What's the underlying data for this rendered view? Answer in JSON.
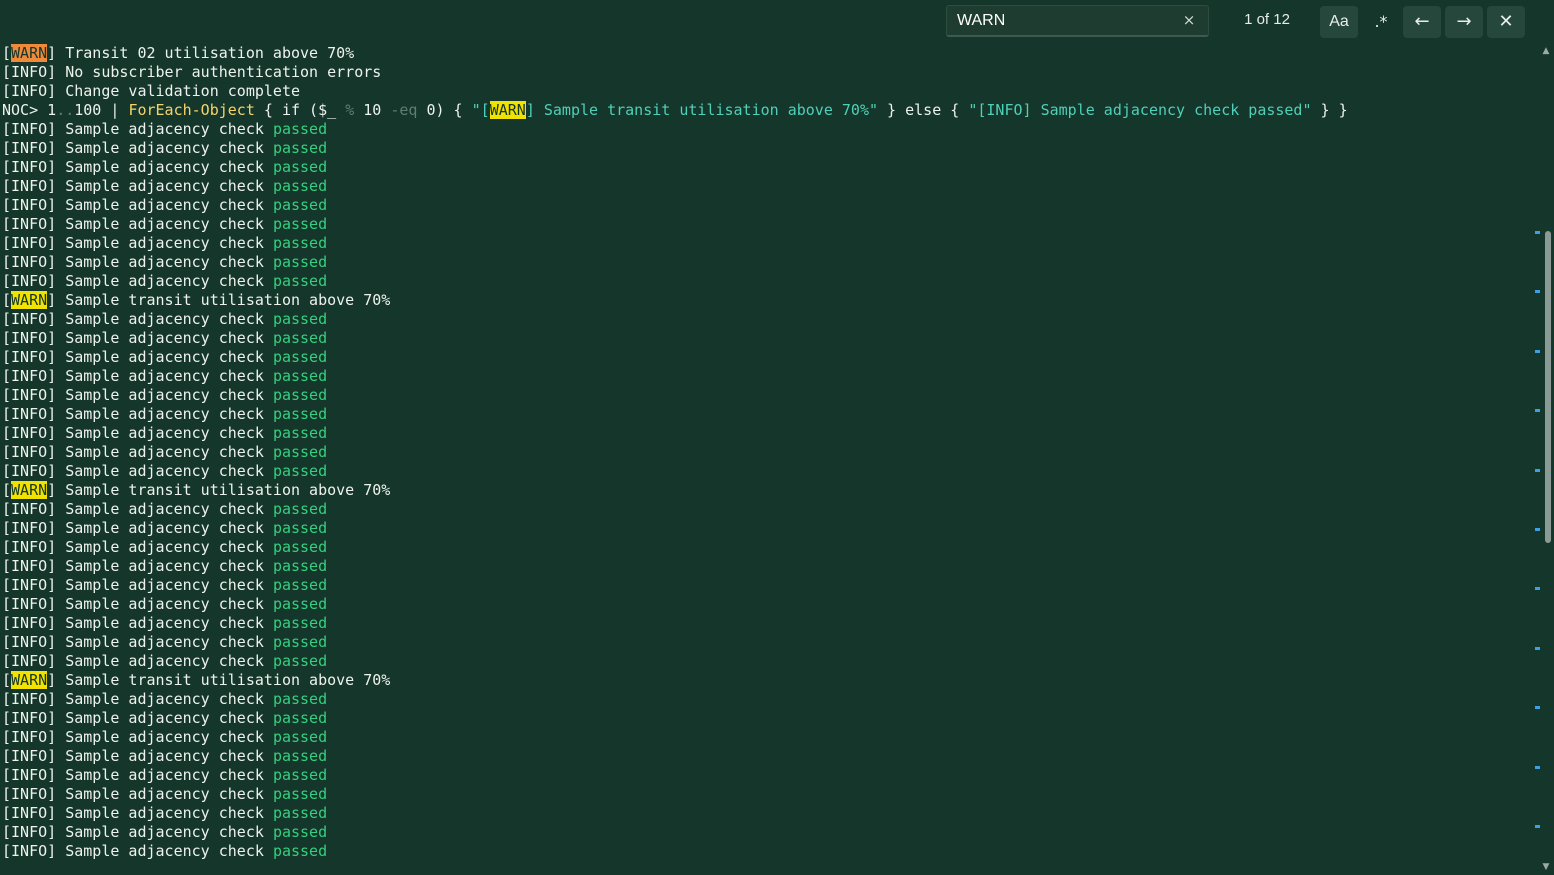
{
  "find": {
    "query": "WARN",
    "clear_icon": "×",
    "match_count": "1 of 12",
    "case_label": "Aa",
    "regex_label": ".*",
    "prev_icon": "←",
    "next_icon": "→",
    "close_icon": "✕"
  },
  "terminal": {
    "lines": [
      [
        {
          "t": "["
        },
        {
          "t": "WARN",
          "c": "hl-cur"
        },
        {
          "t": "] Transit 02 utilisation above 70%"
        }
      ],
      [
        {
          "t": "[INFO] No subscriber authentication errors"
        }
      ],
      [
        {
          "t": "[INFO] Change validation complete"
        }
      ],
      [
        {
          "t": "NOC> 1"
        },
        {
          "t": "..",
          "c": "cmd-dim"
        },
        {
          "t": "100 | "
        },
        {
          "t": "ForEach-Object",
          "c": "cmd-yellow"
        },
        {
          "t": " { if ($_ "
        },
        {
          "t": "%",
          "c": "cmd-dim"
        },
        {
          "t": " 10 "
        },
        {
          "t": "-eq",
          "c": "cmd-dim"
        },
        {
          "t": " 0) { "
        },
        {
          "t": "\"[",
          "c": "cmd-str"
        },
        {
          "t": "WARN",
          "c": "hl"
        },
        {
          "t": "] Sample transit utilisation above 70%\"",
          "c": "cmd-str"
        },
        {
          "t": " } else { "
        },
        {
          "t": "\"[INFO] Sample adjacency check passed\"",
          "c": "cmd-str"
        },
        {
          "t": " } }"
        }
      ],
      [
        {
          "t": "[INFO] Sample adjacency check "
        },
        {
          "t": "passed",
          "c": "passed"
        }
      ],
      [
        {
          "t": "[INFO] Sample adjacency check "
        },
        {
          "t": "passed",
          "c": "passed"
        }
      ],
      [
        {
          "t": "[INFO] Sample adjacency check "
        },
        {
          "t": "passed",
          "c": "passed"
        }
      ],
      [
        {
          "t": "[INFO] Sample adjacency check "
        },
        {
          "t": "passed",
          "c": "passed"
        }
      ],
      [
        {
          "t": "[INFO] Sample adjacency check "
        },
        {
          "t": "passed",
          "c": "passed"
        }
      ],
      [
        {
          "t": "[INFO] Sample adjacency check "
        },
        {
          "t": "passed",
          "c": "passed"
        }
      ],
      [
        {
          "t": "[INFO] Sample adjacency check "
        },
        {
          "t": "passed",
          "c": "passed"
        }
      ],
      [
        {
          "t": "[INFO] Sample adjacency check "
        },
        {
          "t": "passed",
          "c": "passed"
        }
      ],
      [
        {
          "t": "[INFO] Sample adjacency check "
        },
        {
          "t": "passed",
          "c": "passed"
        }
      ],
      [
        {
          "t": "["
        },
        {
          "t": "WARN",
          "c": "hl"
        },
        {
          "t": "] Sample transit utilisation above 70%"
        }
      ],
      [
        {
          "t": "[INFO] Sample adjacency check "
        },
        {
          "t": "passed",
          "c": "passed"
        }
      ],
      [
        {
          "t": "[INFO] Sample adjacency check "
        },
        {
          "t": "passed",
          "c": "passed"
        }
      ],
      [
        {
          "t": "[INFO] Sample adjacency check "
        },
        {
          "t": "passed",
          "c": "passed"
        }
      ],
      [
        {
          "t": "[INFO] Sample adjacency check "
        },
        {
          "t": "passed",
          "c": "passed"
        }
      ],
      [
        {
          "t": "[INFO] Sample adjacency check "
        },
        {
          "t": "passed",
          "c": "passed"
        }
      ],
      [
        {
          "t": "[INFO] Sample adjacency check "
        },
        {
          "t": "passed",
          "c": "passed"
        }
      ],
      [
        {
          "t": "[INFO] Sample adjacency check "
        },
        {
          "t": "passed",
          "c": "passed"
        }
      ],
      [
        {
          "t": "[INFO] Sample adjacency check "
        },
        {
          "t": "passed",
          "c": "passed"
        }
      ],
      [
        {
          "t": "[INFO] Sample adjacency check "
        },
        {
          "t": "passed",
          "c": "passed"
        }
      ],
      [
        {
          "t": "["
        },
        {
          "t": "WARN",
          "c": "hl"
        },
        {
          "t": "] Sample transit utilisation above 70%"
        }
      ],
      [
        {
          "t": "[INFO] Sample adjacency check "
        },
        {
          "t": "passed",
          "c": "passed"
        }
      ],
      [
        {
          "t": "[INFO] Sample adjacency check "
        },
        {
          "t": "passed",
          "c": "passed"
        }
      ],
      [
        {
          "t": "[INFO] Sample adjacency check "
        },
        {
          "t": "passed",
          "c": "passed"
        }
      ],
      [
        {
          "t": "[INFO] Sample adjacency check "
        },
        {
          "t": "passed",
          "c": "passed"
        }
      ],
      [
        {
          "t": "[INFO] Sample adjacency check "
        },
        {
          "t": "passed",
          "c": "passed"
        }
      ],
      [
        {
          "t": "[INFO] Sample adjacency check "
        },
        {
          "t": "passed",
          "c": "passed"
        }
      ],
      [
        {
          "t": "[INFO] Sample adjacency check "
        },
        {
          "t": "passed",
          "c": "passed"
        }
      ],
      [
        {
          "t": "[INFO] Sample adjacency check "
        },
        {
          "t": "passed",
          "c": "passed"
        }
      ],
      [
        {
          "t": "[INFO] Sample adjacency check "
        },
        {
          "t": "passed",
          "c": "passed"
        }
      ],
      [
        {
          "t": "["
        },
        {
          "t": "WARN",
          "c": "hl"
        },
        {
          "t": "] Sample transit utilisation above 70%"
        }
      ],
      [
        {
          "t": "[INFO] Sample adjacency check "
        },
        {
          "t": "passed",
          "c": "passed"
        }
      ],
      [
        {
          "t": "[INFO] Sample adjacency check "
        },
        {
          "t": "passed",
          "c": "passed"
        }
      ],
      [
        {
          "t": "[INFO] Sample adjacency check "
        },
        {
          "t": "passed",
          "c": "passed"
        }
      ],
      [
        {
          "t": "[INFO] Sample adjacency check "
        },
        {
          "t": "passed",
          "c": "passed"
        }
      ],
      [
        {
          "t": "[INFO] Sample adjacency check "
        },
        {
          "t": "passed",
          "c": "passed"
        }
      ],
      [
        {
          "t": "[INFO] Sample adjacency check "
        },
        {
          "t": "passed",
          "c": "passed"
        }
      ],
      [
        {
          "t": "[INFO] Sample adjacency check "
        },
        {
          "t": "passed",
          "c": "passed"
        }
      ],
      [
        {
          "t": "[INFO] Sample adjacency check "
        },
        {
          "t": "passed",
          "c": "passed"
        }
      ],
      [
        {
          "t": "[INFO] Sample adjacency check "
        },
        {
          "t": "passed",
          "c": "passed"
        }
      ]
    ]
  },
  "scrollbar": {
    "up_icon": "▲",
    "down_icon": "▼",
    "thumb_start_fraction": 0.225,
    "thumb_size_fraction": 0.375,
    "match_marker_count": 12
  },
  "colors": {
    "background": "#15362a",
    "passed": "#35d07f",
    "match_highlight": "#f2e200",
    "current_match": "#ef8a3a",
    "match_marker": "#3aa0e8"
  }
}
